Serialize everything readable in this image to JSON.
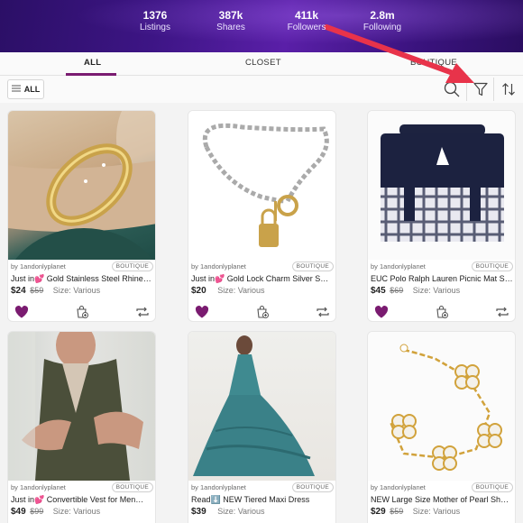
{
  "stats": [
    {
      "value": "1376",
      "label": "Listings"
    },
    {
      "value": "387k",
      "label": "Shares"
    },
    {
      "value": "411k",
      "label": "Followers"
    },
    {
      "value": "2.8m",
      "label": "Following"
    }
  ],
  "tabs": {
    "all": "ALL",
    "closet": "CLOSET",
    "boutique": "BOUTIQUE"
  },
  "toolbar": {
    "all_label": "ALL",
    "search_icon": "search-icon",
    "filter_icon": "filter-icon",
    "sort_icon": "sort-icon"
  },
  "colors": {
    "accent": "#7a1b70",
    "annotation_arrow": "#e8334a"
  },
  "listings": [
    {
      "seller": "by 1andonlyplanet",
      "badge": "BOUTIQUE",
      "title": "Just in💕 Gold Stainless Steel Rhine…",
      "price": "$24",
      "original_price": "$59",
      "size": "Size: Various",
      "liked": true
    },
    {
      "seller": "by 1andonlyplanet",
      "badge": "BOUTIQUE",
      "title": "Just in💕 Gold Lock Charm Silver S…",
      "price": "$20",
      "original_price": "",
      "size": "Size: Various",
      "liked": true
    },
    {
      "seller": "by 1andonlyplanet",
      "badge": "BOUTIQUE",
      "title": "EUC Polo Ralph Lauren Picnic Mat S…",
      "price": "$45",
      "original_price": "$69",
      "size": "Size: Various",
      "liked": true
    },
    {
      "seller": "by 1andonlyplanet",
      "badge": "BOUTIQUE",
      "title": "Just in💕 Convertible Vest for Men…",
      "price": "$49",
      "original_price": "$99",
      "size": "Size: Various",
      "liked": false
    },
    {
      "seller": "by 1andonlyplanet",
      "badge": "BOUTIQUE",
      "title": "Read⬇️ NEW Tiered Maxi Dress",
      "price": "$39",
      "original_price": "",
      "size": "Size: Various",
      "liked": false
    },
    {
      "seller": "by 1andonlyplanet",
      "badge": "BOUTIQUE",
      "title": "NEW Large Size Mother of Pearl She…",
      "price": "$29",
      "original_price": "$59",
      "size": "Size: Various",
      "liked": false
    }
  ]
}
